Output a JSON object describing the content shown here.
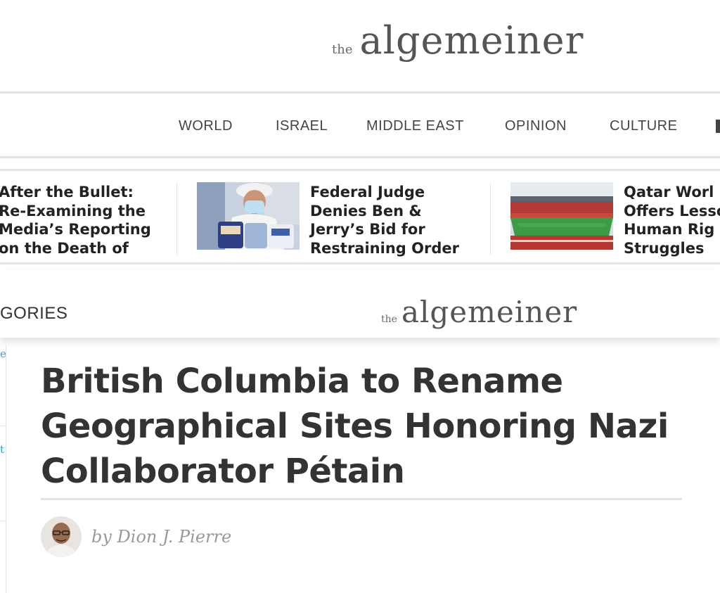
{
  "logo": {
    "the": "the",
    "name": "algemeiner"
  },
  "nav": {
    "items": [
      "WORLD",
      "ISRAEL",
      "MIDDLE EAST",
      "OPINION",
      "CULTURE"
    ]
  },
  "strip": {
    "stories": [
      {
        "lines": [
          "After the Bullet:",
          "Re-Examining the",
          "Media’s Reporting",
          "on the Death of"
        ]
      },
      {
        "lines": [
          "Federal Judge",
          "Denies Ben &",
          "Jerry’s Bid for",
          "Restraining Order"
        ]
      },
      {
        "lines": [
          "Qatar Worl",
          "Offers Lesso",
          "Human Rig",
          "Struggles"
        ]
      }
    ]
  },
  "sticky": {
    "categories_label": "GORIES"
  },
  "sidebar": {
    "chars": [
      "e",
      "t"
    ]
  },
  "article": {
    "title": "British Columbia to Rename Geographical Sites Honoring Nazi Collaborator Pétain",
    "byline": "by Dion J. Pierre"
  },
  "colors": {
    "link_blue": "#3a9ad9",
    "rule_gray": "#e3e3e3",
    "text_dark": "#333333"
  }
}
